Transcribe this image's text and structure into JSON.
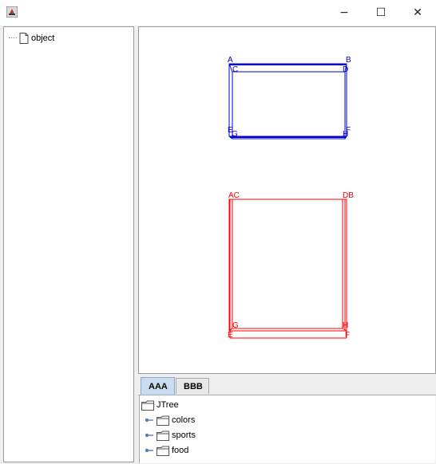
{
  "window": {
    "minimize_glyph": "−",
    "maximize_glyph": "☐",
    "close_glyph": "✕"
  },
  "left_tree": {
    "root_label": "object"
  },
  "canvas": {
    "blue_box": {
      "color": "#0000cc",
      "labels": {
        "a": "A",
        "b": "B",
        "c": "C",
        "d": "D",
        "e": "E",
        "f": "F",
        "g": "G",
        "h": "H"
      }
    },
    "red_box": {
      "color": "#ff0000",
      "labels": {
        "ac": "AC",
        "db": "DB",
        "g": "G",
        "h": "H",
        "e": "E",
        "f": "F"
      }
    }
  },
  "tabs": [
    {
      "label": "AAA",
      "active": true
    },
    {
      "label": "BBB",
      "active": false
    }
  ],
  "jtree": {
    "root": "JTree",
    "children": [
      "colors",
      "sports",
      "food"
    ]
  }
}
